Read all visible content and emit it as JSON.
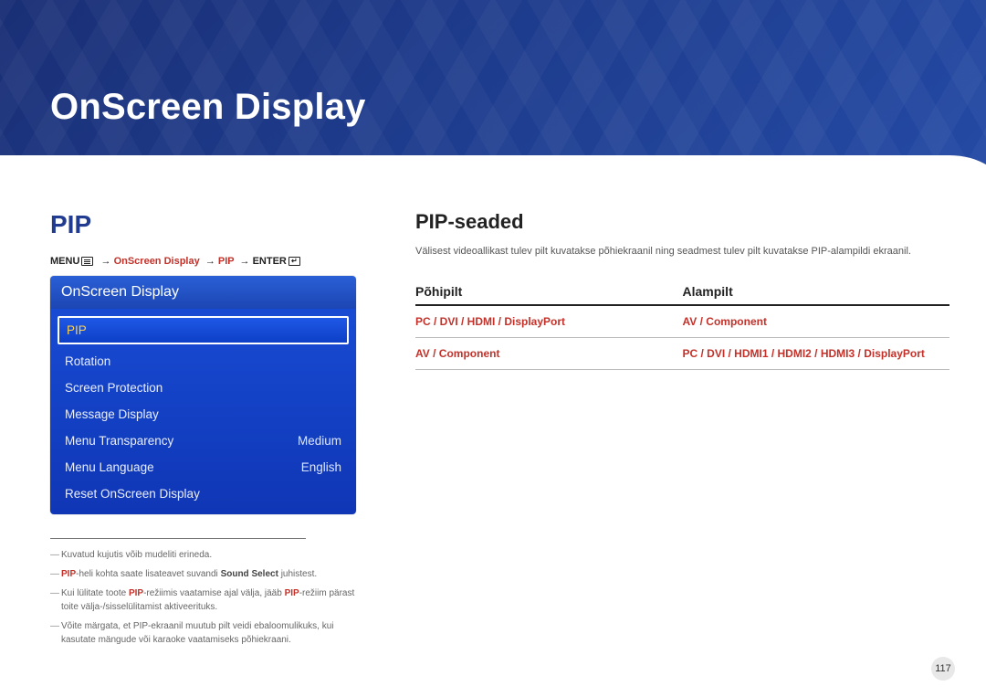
{
  "hero": {
    "title": "OnScreen Display"
  },
  "left": {
    "section_title": "PIP",
    "path": {
      "menu_label": "MENU",
      "seg1": "OnScreen Display",
      "seg2": "PIP",
      "enter_label": "ENTER"
    },
    "osd": {
      "header": "OnScreen Display",
      "rows": [
        {
          "label": "PIP",
          "value": "",
          "selected": true
        },
        {
          "label": "Rotation",
          "value": ""
        },
        {
          "label": "Screen Protection",
          "value": ""
        },
        {
          "label": "Message Display",
          "value": ""
        },
        {
          "label": "Menu Transparency",
          "value": "Medium"
        },
        {
          "label": "Menu Language",
          "value": "English"
        },
        {
          "label": "Reset OnScreen Display",
          "value": ""
        }
      ]
    },
    "notes": {
      "n1": "Kuvatud kujutis võib mudeliti erineda.",
      "n2_pre": "",
      "n2_hl1": "PIP",
      "n2_mid": "-heli kohta saate lisateavet suvandi ",
      "n2_b": "Sound Select",
      "n2_post": " juhistest.",
      "n3_pre": "Kui lülitate toote ",
      "n3_hl1": "PIP",
      "n3_mid": "-režiimis vaatamise ajal välja, jääb ",
      "n3_hl2": "PIP",
      "n3_post": "-režiim pärast toite välja-/sisselülitamist aktiveerituks.",
      "n4": "Võite märgata, et PIP-ekraanil muutub pilt veidi ebaloomulikuks, kui kasutate mängude või karaoke vaatamiseks põhiekraani."
    }
  },
  "right": {
    "h2": "PIP-seaded",
    "desc": "Välisest videoallikast tulev pilt kuvatakse põhiekraanil ning seadmest tulev pilt kuvatakse PIP-alampildi ekraanil.",
    "table": {
      "col1": "Põhipilt",
      "col2": "Alampilt",
      "rows": [
        {
          "c1": "PC / DVI / HDMI / DisplayPort",
          "c2": "AV / Component"
        },
        {
          "c1": "AV / Component",
          "c2": "PC / DVI / HDMI1 / HDMI2 / HDMI3 / DisplayPort"
        }
      ]
    }
  },
  "page_number": "117"
}
